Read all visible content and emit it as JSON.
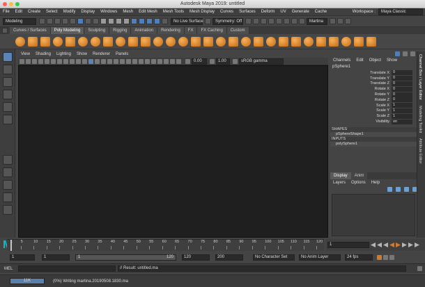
{
  "window": {
    "title": "Autodesk Maya 2019: untitled"
  },
  "menubar": {
    "items": [
      "File",
      "Edit",
      "Create",
      "Select",
      "Modify",
      "Display",
      "Windows",
      "Mesh",
      "Edit Mesh",
      "Mesh Tools",
      "Mesh Display",
      "Curves",
      "Surfaces",
      "Deform",
      "UV",
      "Generate",
      "Cache"
    ],
    "workspace_label": "Workspace :",
    "workspace_value": "Maya Classic"
  },
  "statusline": {
    "mode": "Modeling",
    "live_surface": "No Live Surface",
    "symmetry": "Symmetry: Off",
    "user": "Martina"
  },
  "shelf": {
    "tabs": [
      "Curves / Surfaces",
      "Poly Modeling",
      "Sculpting",
      "Rigging",
      "Animation",
      "Rendering",
      "FX",
      "FX Caching",
      "Custom"
    ],
    "active_tab": "Poly Modeling"
  },
  "viewport": {
    "menu": [
      "View",
      "Shading",
      "Lighting",
      "Show",
      "Renderer",
      "Panels"
    ],
    "exposure": "0.00",
    "gamma": "1.00",
    "color_space": "sRGB gamma"
  },
  "channelbox": {
    "menu": [
      "Channels",
      "Edit",
      "Object",
      "Show"
    ],
    "object": "pSphere1",
    "attributes": [
      {
        "label": "Translate X",
        "value": "0"
      },
      {
        "label": "Translate Y",
        "value": "0"
      },
      {
        "label": "Translate Z",
        "value": "0"
      },
      {
        "label": "Rotate X",
        "value": "0"
      },
      {
        "label": "Rotate Y",
        "value": "0"
      },
      {
        "label": "Rotate Z",
        "value": "0"
      },
      {
        "label": "Scale X",
        "value": "1"
      },
      {
        "label": "Scale Y",
        "value": "1"
      },
      {
        "label": "Scale Z",
        "value": "1"
      },
      {
        "label": "Visibility",
        "value": "on"
      }
    ],
    "shapes_header": "SHAPES",
    "shape": "pSphereShape1",
    "inputs_header": "INPUTS",
    "input": "polySphere1",
    "side_tabs": [
      "Channel Box / Layer Editor",
      "Modeling Toolkit",
      "Attribute Editor"
    ]
  },
  "layers": {
    "tabs": [
      "Display",
      "Anim"
    ],
    "active_tab": "Display",
    "menu": [
      "Layers",
      "Options",
      "Help"
    ]
  },
  "timeline": {
    "ticks": [
      "1",
      "5",
      "10",
      "15",
      "20",
      "25",
      "30",
      "35",
      "40",
      "45",
      "50",
      "55",
      "60",
      "65",
      "70",
      "75",
      "80",
      "85",
      "90",
      "95",
      "100",
      "105",
      "110",
      "115",
      "120"
    ],
    "current_frame": "1"
  },
  "range": {
    "start": "1",
    "playback_start": "1",
    "range_start_label": "1",
    "range_end_label": "120",
    "playback_end": "120",
    "end": "200",
    "character_set": "No Character Set",
    "anim_layer": "No Anim Layer",
    "fps": "24 fps"
  },
  "command": {
    "mode": "MEL",
    "result": "// Result: untitled.ma"
  },
  "help": {
    "memory": "11K",
    "message": "(0%) Writing martina.20190508.1830.ma"
  }
}
